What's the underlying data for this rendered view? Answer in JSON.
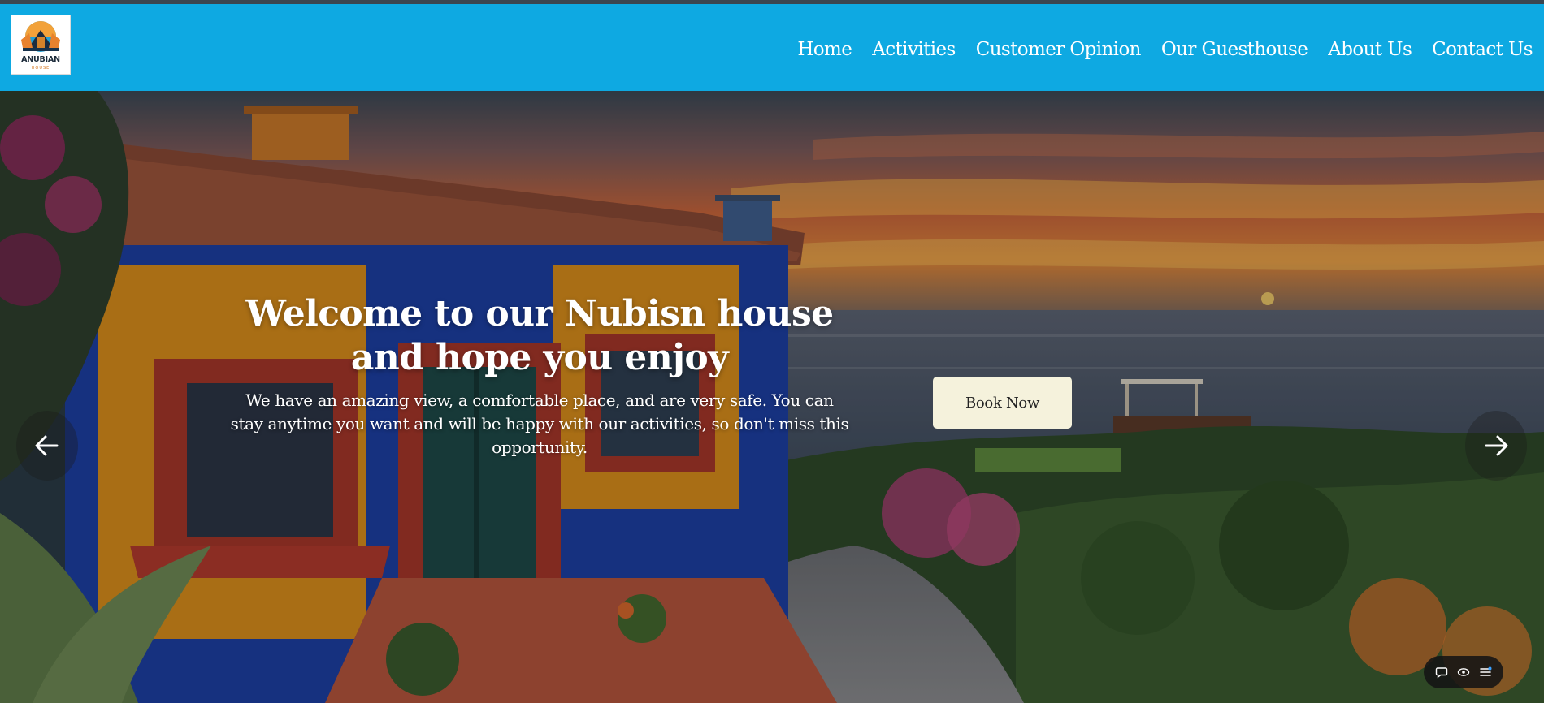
{
  "brand": {
    "logo_text": "ANUBIAN",
    "logo_sub": "HOUSE"
  },
  "nav": {
    "items": [
      {
        "label": "Home"
      },
      {
        "label": "Activities"
      },
      {
        "label": "Customer Opinion"
      },
      {
        "label": "Our Guesthouse"
      },
      {
        "label": "About Us"
      },
      {
        "label": "Contact Us"
      }
    ]
  },
  "hero": {
    "title": "Welcome to our Nubisn house and hope you enjoy",
    "description": "We have an amazing view, a comfortable place, and are very safe. You can stay anytime you want and will be happy with our activities, so don't miss this opportunity.",
    "cta_label": "Book Now",
    "prev_icon": "arrow-left-icon",
    "next_icon": "arrow-right-icon"
  },
  "widget": {
    "icons": [
      "chat-icon",
      "eye-icon",
      "menu-icon"
    ]
  },
  "colors": {
    "navbar": "#0ea9e2",
    "cta_background": "#f5f2dc",
    "text_light": "#ffffff"
  }
}
